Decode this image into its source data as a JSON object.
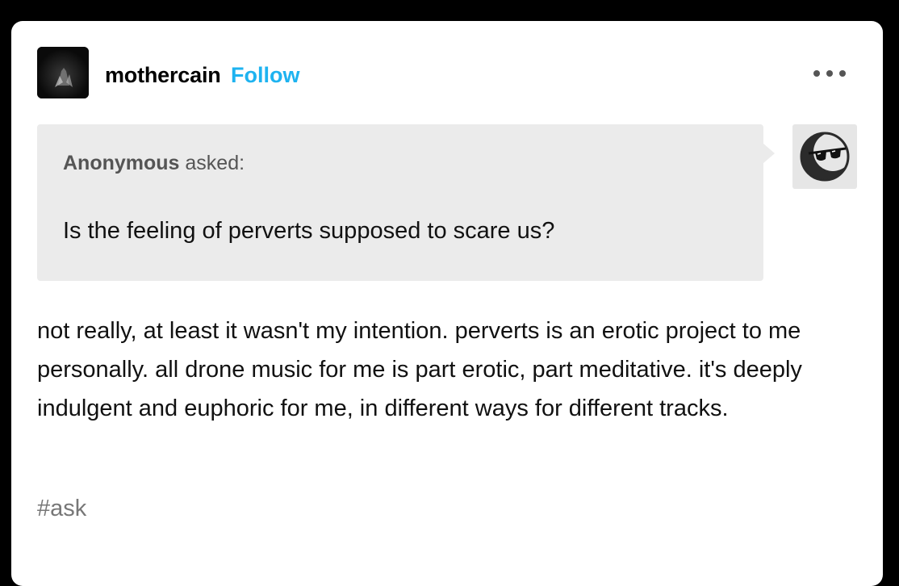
{
  "post": {
    "author": "mothercain",
    "follow_label": "Follow",
    "more_icon": "more-horizontal-icon",
    "ask": {
      "asker": "Anonymous",
      "asked_label": "asked:",
      "question": "Is the feeling of perverts supposed to scare us?"
    },
    "answer": "not really, at least it wasn't my intention. perverts is an erotic project to me personally. all drone music for me is part erotic, part meditative. it's deeply indulgent and euphoric for me, in different ways for different tracks.",
    "tags": [
      "#ask"
    ]
  },
  "colors": {
    "follow_blue": "#1eb3f0",
    "ask_bubble_bg": "#ebebeb",
    "tag_gray": "#777777"
  }
}
